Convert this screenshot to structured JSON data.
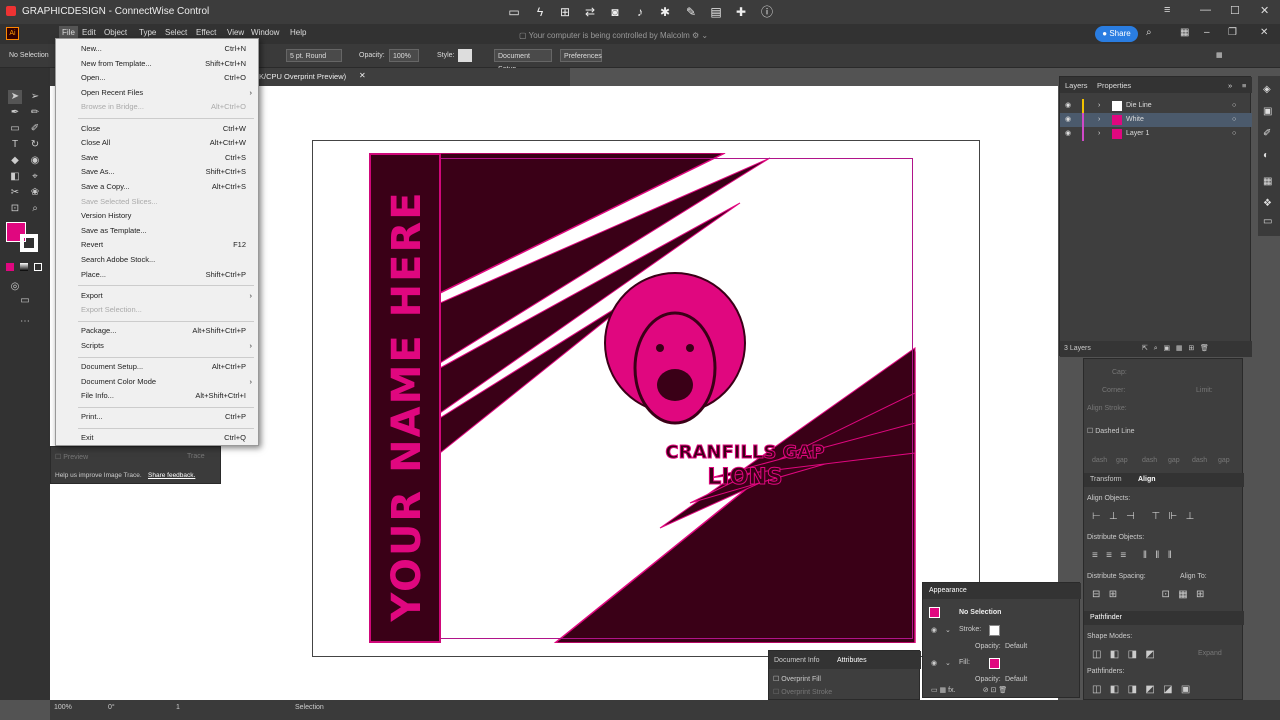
{
  "window": {
    "title": "GRAPHICDESIGN - ConnectWise Control",
    "controlled_msg": "Your computer is being controlled by Malcolm",
    "share_label": "Share"
  },
  "menu": [
    "File",
    "Edit",
    "Object",
    "Type",
    "Select",
    "Effect",
    "View",
    "Window",
    "Help"
  ],
  "control_bar": {
    "selection": "No Selection",
    "stroke_profile": "5 pt. Round",
    "opacity_label": "Opacity:",
    "opacity_value": "100%",
    "style_label": "Style:",
    "doc_setup": "Document Setup",
    "preferences": "Preferences"
  },
  "doc_tab": "K/CPU Overprint Preview)",
  "file_menu": [
    {
      "label": "New...",
      "shortcut": "Ctrl+N",
      "disabled": false
    },
    {
      "label": "New from Template...",
      "shortcut": "Shift+Ctrl+N",
      "disabled": false
    },
    {
      "label": "Open...",
      "shortcut": "Ctrl+O",
      "disabled": false
    },
    {
      "label": "Open Recent Files",
      "shortcut": "",
      "disabled": false,
      "submenu": true
    },
    {
      "label": "Browse in Bridge...",
      "shortcut": "Alt+Ctrl+O",
      "disabled": true
    },
    {
      "sep": true
    },
    {
      "label": "Close",
      "shortcut": "Ctrl+W",
      "disabled": false
    },
    {
      "label": "Close All",
      "shortcut": "Alt+Ctrl+W",
      "disabled": false
    },
    {
      "label": "Save",
      "shortcut": "Ctrl+S",
      "disabled": false
    },
    {
      "label": "Save As...",
      "shortcut": "Shift+Ctrl+S",
      "disabled": false
    },
    {
      "label": "Save a Copy...",
      "shortcut": "Alt+Ctrl+S",
      "disabled": false
    },
    {
      "label": "Save Selected Slices...",
      "shortcut": "",
      "disabled": true
    },
    {
      "label": "Version History",
      "shortcut": "",
      "disabled": false
    },
    {
      "label": "Save as Template...",
      "shortcut": "",
      "disabled": false
    },
    {
      "label": "Revert",
      "shortcut": "F12",
      "disabled": false
    },
    {
      "label": "Search Adobe Stock...",
      "shortcut": "",
      "disabled": false
    },
    {
      "label": "Place...",
      "shortcut": "Shift+Ctrl+P",
      "disabled": false
    },
    {
      "sep": true
    },
    {
      "label": "Export",
      "shortcut": "",
      "disabled": false,
      "submenu": true
    },
    {
      "label": "Export Selection...",
      "shortcut": "",
      "disabled": true
    },
    {
      "sep": true
    },
    {
      "label": "Package...",
      "shortcut": "Alt+Shift+Ctrl+P",
      "disabled": false
    },
    {
      "label": "Scripts",
      "shortcut": "",
      "disabled": false,
      "submenu": true
    },
    {
      "sep": true
    },
    {
      "label": "Document Setup...",
      "shortcut": "Alt+Ctrl+P",
      "disabled": false
    },
    {
      "label": "Document Color Mode",
      "shortcut": "",
      "disabled": false,
      "submenu": true
    },
    {
      "label": "File Info...",
      "shortcut": "Alt+Shift+Ctrl+I",
      "disabled": false
    },
    {
      "sep": true
    },
    {
      "label": "Print...",
      "shortcut": "Ctrl+P",
      "disabled": false
    },
    {
      "sep": true
    },
    {
      "label": "Exit",
      "shortcut": "Ctrl+Q",
      "disabled": false
    }
  ],
  "trace": {
    "preview": "Preview",
    "trace": "Trace",
    "help": "Help us improve Image Trace.",
    "feedback": "Share feedback."
  },
  "artwork": {
    "name_text": "YOUR NAME HERE",
    "line1": "CRANFILLS GAP",
    "line2": "LIONS"
  },
  "layers_panel": {
    "tabs": [
      "Layers",
      "Properties"
    ],
    "layers": [
      "Die Line",
      "White",
      "Layer 1"
    ],
    "count": "3 Layers"
  },
  "props_panel": {
    "cap": "Cap:",
    "corner": "Corner:",
    "limit": "Limit:",
    "align_stroke": "Align Stroke:",
    "dashed_line": "Dashed Line",
    "dash_gap": [
      "dash",
      "gap",
      "dash",
      "gap",
      "dash",
      "gap"
    ],
    "tabs": [
      "Transform",
      "Align"
    ],
    "align_objects": "Align Objects:",
    "distribute_objects": "Distribute Objects:",
    "distribute_spacing": "Distribute Spacing:",
    "align_to": "Align To:",
    "pathfinder": "Pathfinder",
    "shape_modes": "Shape Modes:",
    "expand": "Expand",
    "pathfinders": "Pathfinders:"
  },
  "appearance": {
    "title": "Appearance",
    "no_selection": "No Selection",
    "stroke": "Stroke:",
    "opacity": "Opacity:",
    "default": "Default",
    "fill": "Fill:",
    "fx": "fx."
  },
  "docinfo": {
    "tabs": [
      "Document Info",
      "Attributes"
    ],
    "overprint_fill": "Overprint Fill",
    "overprint_stroke": "Overprint Stroke"
  },
  "status": {
    "zoom": "100%",
    "rotation": "0°",
    "artboard": "1",
    "tool": "Selection"
  },
  "colors": {
    "magenta": "#e0077f",
    "maroon": "#3a0017",
    "ui_dark": "#323232"
  }
}
